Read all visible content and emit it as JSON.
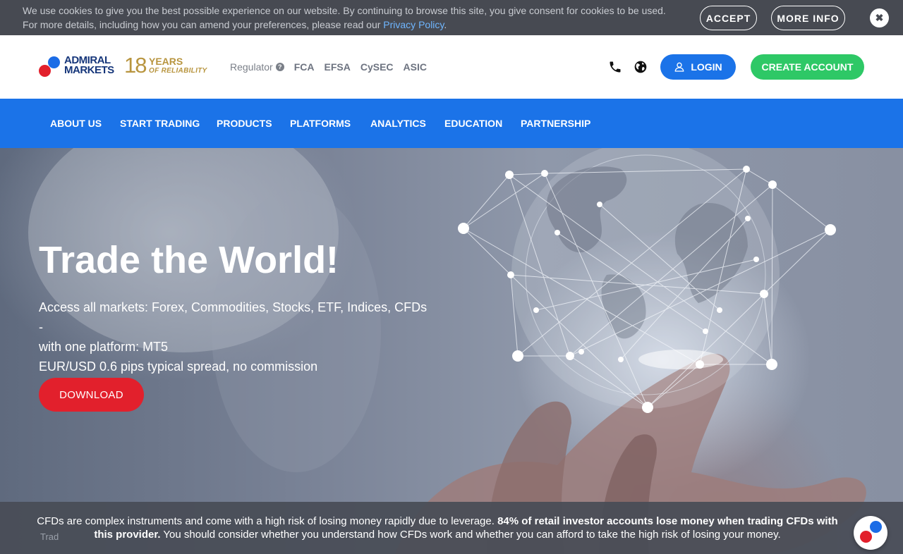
{
  "cookie_bar": {
    "line1": "We use cookies to give you the best possible experience on our website. By continuing to browse this site, you give consent for cookies to be used.",
    "line2_prefix": "For more details, including how you can amend your preferences, please read our ",
    "privacy_link": "Privacy Policy",
    "line2_suffix": ".",
    "accept_label": "ACCEPT",
    "more_info_label": "MORE INFO",
    "close_glyph": "✖"
  },
  "header": {
    "logo": {
      "brand_line1": "ADMIRAL",
      "brand_line2": "MARKETS",
      "years_number": "18",
      "years_line1": "YEARS",
      "years_line2": "OF RELIABILITY"
    },
    "regulator_label": "Regulator",
    "regulator_help_glyph": "?",
    "regulators": [
      "FCA",
      "EFSA",
      "CySEC",
      "ASIC"
    ],
    "icons": [
      "phone-icon",
      "globe-icon",
      "user-icon"
    ],
    "login_label": "LOGIN",
    "create_account_label": "CREATE ACCOUNT"
  },
  "nav": {
    "items": [
      "ABOUT US",
      "START TRADING",
      "PRODUCTS",
      "PLATFORMS",
      "ANALYTICS",
      "EDUCATION",
      "PARTNERSHIP"
    ]
  },
  "hero": {
    "title": "Trade the World!",
    "subtitle_line1": "Access all markets: Forex, Commodities, Stocks, ETF, Indices, CFDs -",
    "subtitle_line2": "with one platform: MT5",
    "subtitle_line3": "EUR/USD 0.6 pips typical spread, no commission",
    "download_label": "DOWNLOAD"
  },
  "risk_warning": {
    "text_start": "CFDs are complex instruments and come with a high risk of losing money rapidly due to leverage. ",
    "text_bold": "84% of retail investor accounts lose money when trading CFDs with this provider.",
    "text_end": " You should consider whether you understand how CFDs work and whether you can afford to take the high risk of losing your money.",
    "partial_underlying_text": "Trad"
  },
  "colors": {
    "brand_blue": "#1b73e8",
    "brand_red": "#e2202c",
    "brand_green": "#2ec866",
    "gold": "#b8953f",
    "cookie_bg": "#474a52"
  }
}
